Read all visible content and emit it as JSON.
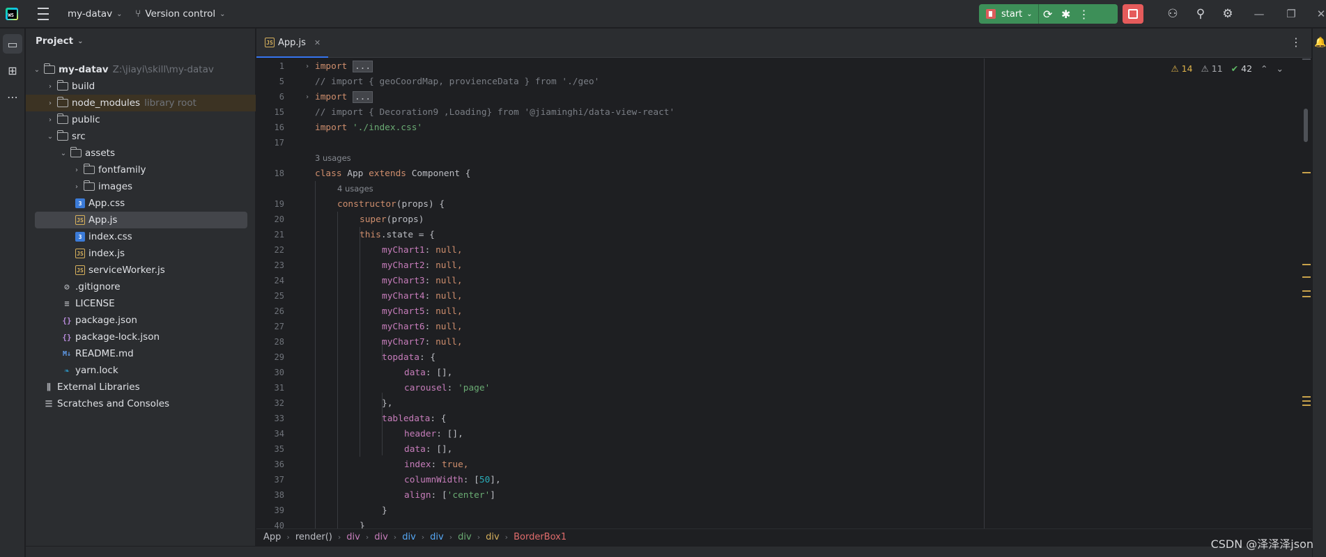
{
  "titlebar": {
    "logo": "WS",
    "project_name": "my-datav",
    "vcs_label": "Version control",
    "run_config": "start"
  },
  "toolstrip": {
    "icons": [
      "project-icon",
      "structure-icon",
      "more-icon"
    ]
  },
  "project_panel": {
    "title": "Project",
    "tree": [
      {
        "label": "my-datav",
        "hint": "Z:\\jiayi\\skill\\my-datav",
        "type": "folder",
        "expanded": true
      },
      {
        "label": "build",
        "type": "folder"
      },
      {
        "label": "node_modules",
        "hint": "library root",
        "type": "folder"
      },
      {
        "label": "public",
        "type": "folder"
      },
      {
        "label": "src",
        "type": "folder",
        "expanded": true
      },
      {
        "label": "assets",
        "type": "folder",
        "expanded": true
      },
      {
        "label": "fontfamily",
        "type": "folder"
      },
      {
        "label": "images",
        "type": "folder"
      },
      {
        "label": "App.css",
        "type": "css"
      },
      {
        "label": "App.js",
        "type": "js",
        "selected": true
      },
      {
        "label": "index.css",
        "type": "css"
      },
      {
        "label": "index.js",
        "type": "js"
      },
      {
        "label": "serviceWorker.js",
        "type": "js"
      },
      {
        "label": ".gitignore",
        "type": "git"
      },
      {
        "label": "LICENSE",
        "type": "license"
      },
      {
        "label": "package.json",
        "type": "json"
      },
      {
        "label": "package-lock.json",
        "type": "json"
      },
      {
        "label": "README.md",
        "type": "md"
      },
      {
        "label": "yarn.lock",
        "type": "yarn"
      },
      {
        "label": "External Libraries",
        "type": "lib"
      },
      {
        "label": "Scratches and Consoles",
        "type": "scratch"
      }
    ]
  },
  "editor": {
    "tab_label": "App.js",
    "inspections": {
      "warnings": "14",
      "weak_warnings": "11",
      "ok": "42"
    },
    "lines": [
      {
        "n": "1",
        "fold": true
      },
      {
        "n": "5"
      },
      {
        "n": "6",
        "fold": true
      },
      {
        "n": "15"
      },
      {
        "n": "16"
      },
      {
        "n": "17"
      },
      {
        "usages": "3 usages"
      },
      {
        "n": "18"
      },
      {
        "usages": "4 usages"
      },
      {
        "n": "19"
      },
      {
        "n": "20"
      },
      {
        "n": "21"
      },
      {
        "n": "22"
      },
      {
        "n": "23"
      },
      {
        "n": "24"
      },
      {
        "n": "25"
      },
      {
        "n": "26"
      },
      {
        "n": "27"
      },
      {
        "n": "28"
      },
      {
        "n": "29"
      },
      {
        "n": "30"
      },
      {
        "n": "31"
      },
      {
        "n": "32"
      },
      {
        "n": "33"
      },
      {
        "n": "34"
      },
      {
        "n": "35"
      },
      {
        "n": "36"
      },
      {
        "n": "37"
      },
      {
        "n": "38"
      },
      {
        "n": "39"
      },
      {
        "n": "40"
      }
    ],
    "code": {
      "import_kw": "import",
      "folded": "...",
      "geo_comment": "// import { geoCoordMap, provienceData } from './geo'",
      "decoration_comment": "// import { Decoration9 ,Loading} from '@jiaminghi/data-view-react'",
      "index_css": "'./index.css'",
      "class_kw": "class",
      "class_name": " App ",
      "extends_kw": "extends",
      "component": " Component {",
      "constructor": "constructor",
      "props": "(props) {",
      "super_kw": "super",
      "super_args": "(props)",
      "this_kw": "this",
      "state": ".state = {",
      "charts": [
        "myChart1",
        "myChart2",
        "myChart3",
        "myChart4",
        "myChart5",
        "myChart6",
        "myChart7"
      ],
      "null_val": "null,",
      "topdata": "topdata",
      "data_key": "data",
      "empty_arr": "[],",
      "carousel_key": "carousel",
      "page_str": "'page'",
      "close_comma": "},",
      "tabledata": "tabledata",
      "header_key": "header",
      "index_key": "index",
      "true_val": "true,",
      "colwidth_key": "columnWidth",
      "fifty": "50",
      "align_key": "align",
      "center_str": "'center'",
      "close_brace": "}"
    }
  },
  "breadcrumb": [
    "App",
    "render()",
    "div",
    "div",
    "div",
    "div",
    "div",
    "div",
    "BorderBox1"
  ],
  "watermark": "CSDN @泽泽泽json"
}
